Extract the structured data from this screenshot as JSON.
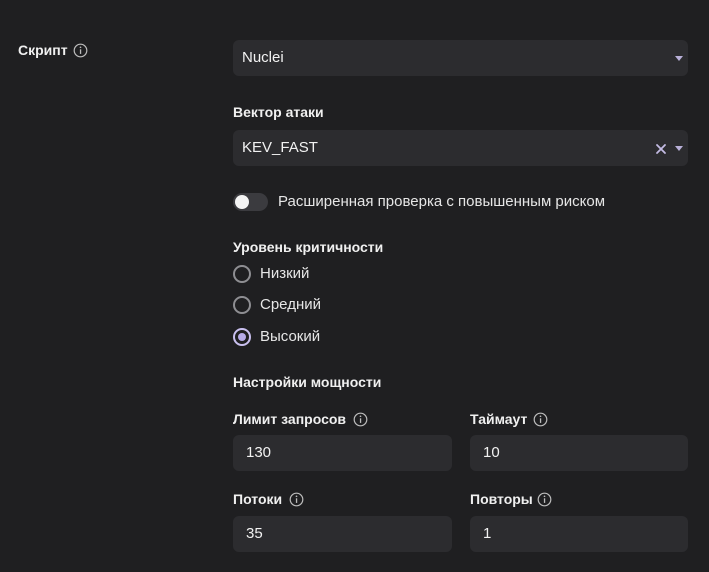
{
  "script": {
    "label": "Скрипт",
    "selected": "Nuclei"
  },
  "attack_vector": {
    "label": "Вектор атаки",
    "selected": "KEV_FAST"
  },
  "extended_check": {
    "label": "Расширенная проверка с повышенным риском",
    "enabled": false
  },
  "severity": {
    "label": "Уровень критичности",
    "options": [
      {
        "label": "Низкий",
        "checked": false
      },
      {
        "label": "Средний",
        "checked": false
      },
      {
        "label": "Высокий",
        "checked": true
      }
    ]
  },
  "power": {
    "label": "Настройки мощности",
    "rate_limit": {
      "label": "Лимит запросов",
      "value": "130"
    },
    "timeout": {
      "label": "Таймаут",
      "value": "10"
    },
    "threads": {
      "label": "Потоки",
      "value": "35"
    },
    "retries": {
      "label": "Повторы",
      "value": "1"
    }
  },
  "colors": {
    "background": "#1f1f21",
    "field": "#2c2c2f",
    "accent": "#b7abe8"
  }
}
